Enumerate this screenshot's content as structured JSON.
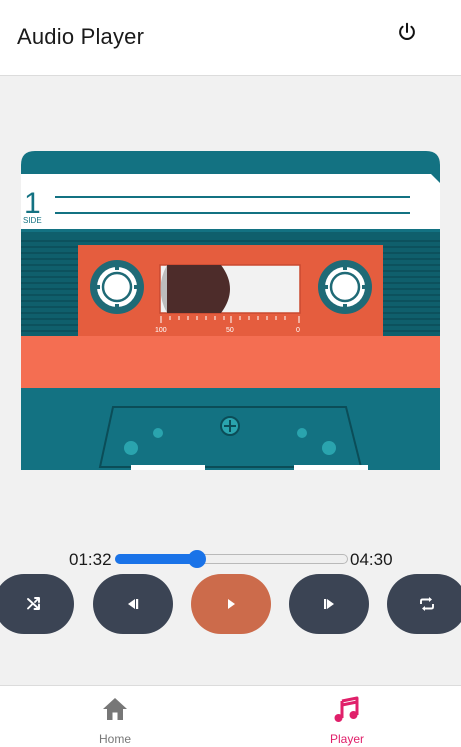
{
  "header": {
    "title": "Audio Player",
    "power_icon": "power-icon"
  },
  "cassette": {
    "side_number": "1",
    "side_label": "SIDE",
    "counter_marks": [
      "100",
      "50",
      "0"
    ],
    "colors": {
      "shell": "#137282",
      "label": "#f46e52",
      "window_panel": "#e55d3e",
      "tape": "#4d2c2a",
      "spool": "#1f6a76"
    }
  },
  "player": {
    "current_time": "01:32",
    "total_time": "04:30",
    "progress": 0.35,
    "controls": [
      {
        "id": "shuffle",
        "icon": "shuffle-icon"
      },
      {
        "id": "previous",
        "icon": "skip-previous-icon"
      },
      {
        "id": "play",
        "icon": "play-icon"
      },
      {
        "id": "next",
        "icon": "skip-next-icon"
      },
      {
        "id": "repeat",
        "icon": "repeat-icon"
      }
    ],
    "colors": {
      "control_bg": "#3b4454",
      "play_bg": "#cc6b4b",
      "accent": "#1a73e8"
    }
  },
  "nav": {
    "items": [
      {
        "label": "Home",
        "icon": "home-icon",
        "active": false
      },
      {
        "label": "Player",
        "icon": "music-note-icon",
        "active": true
      }
    ],
    "active_color": "#e0206a",
    "inactive_color": "#777777"
  }
}
